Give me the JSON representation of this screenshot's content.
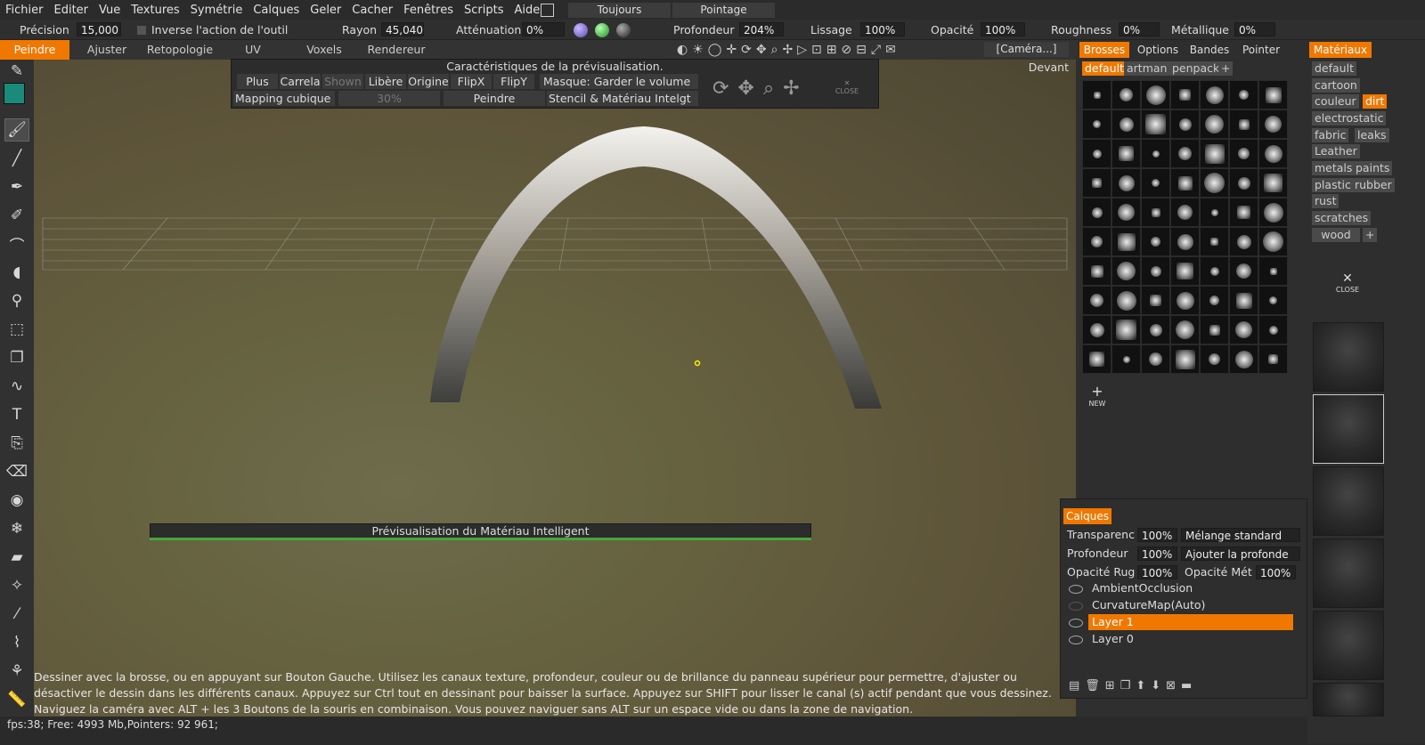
{
  "menu": [
    "Fichier",
    "Editer",
    "Vue",
    "Textures",
    "Symétrie",
    "Calques",
    "Geler",
    "Cacher",
    "Fenêtres",
    "Scripts",
    "Aide"
  ],
  "menu_right": {
    "always": "Toujours",
    "pointing": "Pointage"
  },
  "toolbar": {
    "precision_label": "Précision",
    "precision_value": "15,000",
    "invert_label": "Inverse l'action de l'outil",
    "radius_label": "Rayon",
    "radius_value": "45,040",
    "falloff_label": "Atténuation",
    "falloff_value": "0%",
    "depth_label": "Profondeur",
    "depth_value": "204%",
    "smooth_label": "Lissage",
    "smooth_value": "100%",
    "opacity_label": "Opacité",
    "opacity_value": "100%",
    "roughness_label": "Roughness",
    "roughness_value": "0%",
    "metal_label": "Métallique",
    "metal_value": "0%"
  },
  "tabs": [
    "Peindre",
    "Ajuster",
    "Retopologie",
    "UV",
    "Voxels",
    "Rendereur"
  ],
  "camera": "[Caméra...]",
  "view_label": "Devant",
  "preview": {
    "title": "Caractéristiques de la prévisualisation.",
    "buttons": [
      "Plus",
      "Carrela",
      "Shown",
      "Libère",
      "Origine",
      "FlipX",
      "FlipY"
    ],
    "mask": "Masque: Garder le volume",
    "mapping": "Mapping cubique",
    "pct": "30%",
    "paint": "Peindre",
    "stencil": "Stencil & Matériau Intelgt",
    "close": "CLOSE"
  },
  "smart_preview": "Prévisualisation du Matériau Intelligent",
  "help": "Dessiner avec la brosse, ou en appuyant sur Bouton Gauche. Utilisez les canaux texture, profondeur, couleur ou de brillance du panneau supérieur pour permettre, d'ajuster ou désactiver le dessin dans les différents canaux. Appuyez sur Ctrl tout en dessinant pour baisser la surface. Appuyez sur SHIFT pour lisser le canal (s) actif pendant que vous dessinez. Naviguez la caméra avec ALT + les 3 Boutons de la souris en combinaison.  Vous pouvez naviguer sans ALT sur un espace vide ou dans la zone de navigation.",
  "status": "fps:38;    Free: 4993 Mb,Pointers: 92 961;",
  "brushes": {
    "tabs": [
      "Brosses",
      "Options",
      "Bandes",
      "Pointer"
    ],
    "sets": [
      "default",
      "artman",
      "penpack"
    ],
    "new": "NEW"
  },
  "materials": {
    "title": "Matériaux",
    "items": [
      "default",
      "cartoon",
      "couleur",
      "dirt",
      "electrostatic",
      "fabric",
      "leaks",
      "Leather",
      "metals",
      "paints",
      "plastic",
      "rubber",
      "rust",
      "scratches",
      "wood"
    ],
    "close": "CLOSE"
  },
  "layers": {
    "title": "Calques",
    "transparency_label": "Transparenc",
    "transparency_value": "100%",
    "blend": "Mélange standard",
    "depth_label": "Profondeur",
    "depth_value": "100%",
    "depth_mode": "Ajouter la profonde",
    "rough_label": "Opacité Rug",
    "rough_value": "100%",
    "metal_label": "Opacité Mét",
    "metal_value": "100%",
    "items": [
      "AmbientOcclusion",
      "CurvatureMap(Auto)",
      "Layer 1",
      "Layer 0"
    ]
  },
  "colors": {
    "accent": "#f07800",
    "primary_color": "#1a8a7a"
  }
}
